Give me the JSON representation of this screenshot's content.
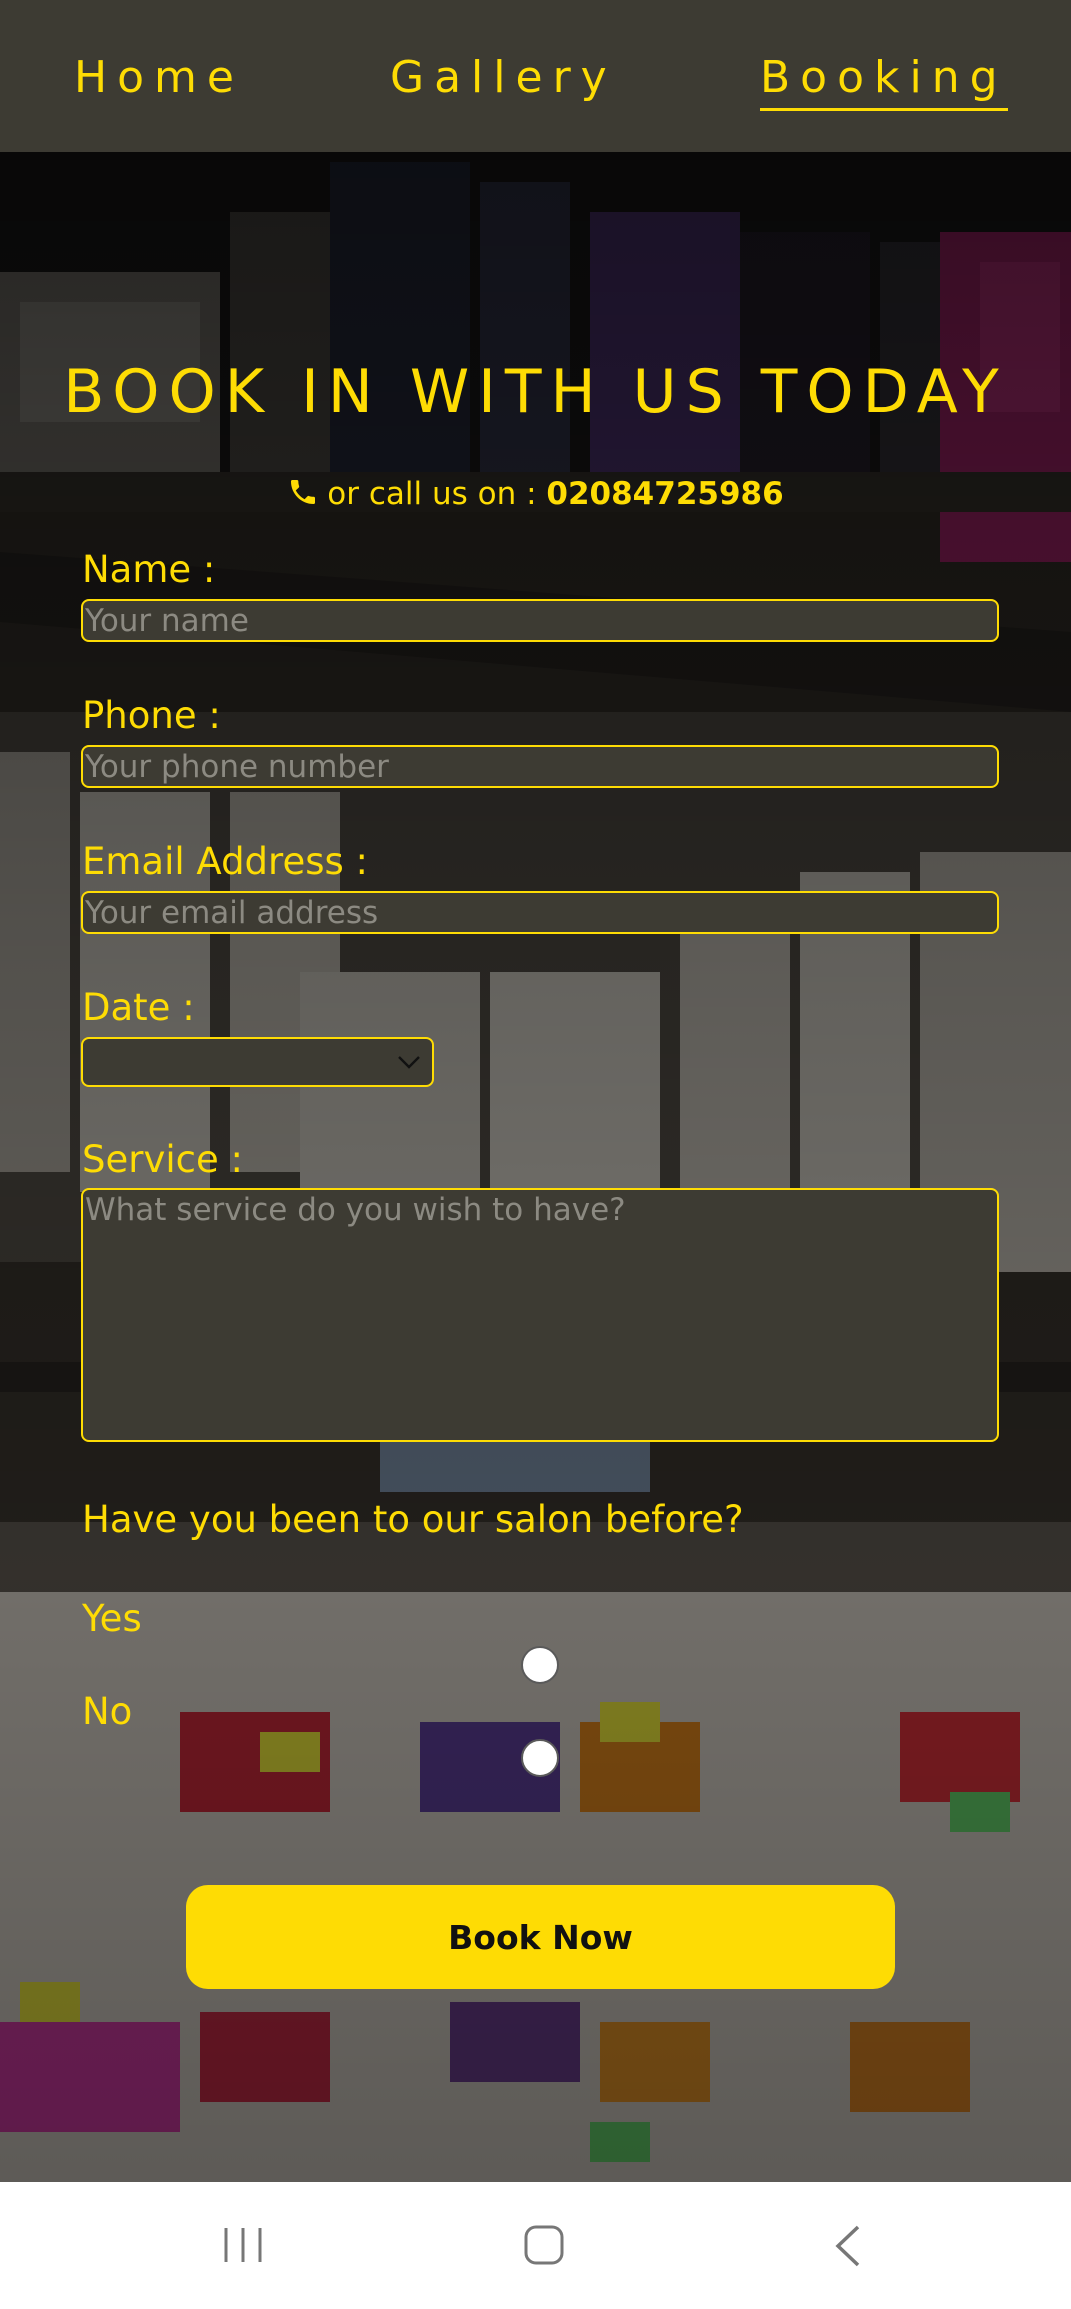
{
  "nav": {
    "items": [
      {
        "label": "Home"
      },
      {
        "label": "Gallery"
      },
      {
        "label": "Booking",
        "active": true
      }
    ]
  },
  "page": {
    "heading": "BOOK IN WITH US TODAY",
    "call_prefix": "or call us on :",
    "call_number": "02084725986"
  },
  "form": {
    "name_label": "Name :",
    "name_placeholder": "Your name",
    "phone_label": "Phone :",
    "phone_placeholder": "Your phone number",
    "email_label": "Email Address :",
    "email_placeholder": "Your email address",
    "date_label": "Date :",
    "service_label": "Service :",
    "service_placeholder": "What service do you wish to have?",
    "visited_question": "Have you been to our salon before?",
    "option_yes": "Yes",
    "option_no": "No",
    "submit_label": "Book Now"
  },
  "system_nav": {
    "icons": [
      "recent-apps-icon",
      "home-icon",
      "back-icon"
    ]
  },
  "colors": {
    "accent": "#fedc04",
    "nav_bg": "#3d3b33",
    "field_bg": "#3d3b33",
    "placeholder": "#8c8a82",
    "system_bar_bg": "#ffffff"
  }
}
